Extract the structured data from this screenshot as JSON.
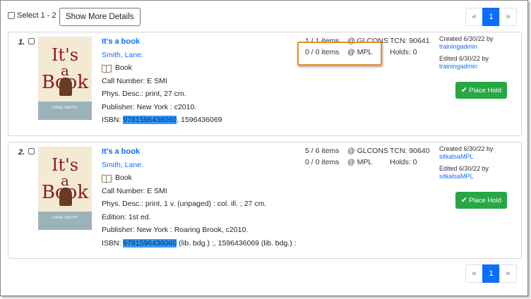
{
  "toolbar": {
    "select_label": "Select 1 - 2",
    "show_details_label": "Show More Details"
  },
  "pager": {
    "prev": "«",
    "page": "1",
    "next": "»"
  },
  "records": [
    {
      "number": "1.",
      "cover": {
        "line1": "It's",
        "line2": "a",
        "line3": "Book",
        "author": "LANE SMITH"
      },
      "title": "It's a book",
      "author": "Smith, Lane.",
      "format": "Book",
      "details": [
        "Call Number: E SMI",
        "Phys. Desc.: print, 27 cm.",
        "Publisher: New York : c2010."
      ],
      "isbn_label": "ISBN: ",
      "isbn_highlight": "9781596436060",
      "isbn_rest": ", 1596436069",
      "holdings": [
        {
          "count": "1 / 1 items",
          "location": "@ GLCONS",
          "extra": "TCN: 90641"
        },
        {
          "count": "0 / 0 items",
          "location": "@ MPL",
          "extra": "Holds: 0"
        }
      ],
      "created": "Created 6/30/22 by",
      "created_by": "trainingadmin",
      "edited": "Edited 6/30/22 by",
      "edited_by": "trainingadmin",
      "hold_label": "Place Hold"
    },
    {
      "number": "2.",
      "cover": {
        "line1": "It's",
        "line2": "a",
        "line3": "Book",
        "author": "LANE SMITH"
      },
      "title": "It's a book",
      "author": "Smith, Lane.",
      "format": "Book",
      "details": [
        "Call Number: E SMI",
        "Phys. Desc.: print, 1 v. (unpaged) : col. ill. ; 27 cm.",
        "Edition: 1st ed.",
        "Publisher: New York : Roaring Brook, c2010."
      ],
      "isbn_label": "ISBN: ",
      "isbn_highlight": "9781596436060",
      "isbn_rest": " (lib. bdg.) :, 1596436069 (lib. bdg.) :",
      "holdings": [
        {
          "count": "5 / 6 items",
          "location": "@ GLCONS",
          "extra": "TCN: 90640"
        },
        {
          "count": "0 / 0 items",
          "location": "@ MPL",
          "extra": "Holds: 0"
        }
      ],
      "created": "Created 6/30/22 by",
      "created_by": "sitkalsaMPL",
      "edited": "Edited 6/30/22 by",
      "edited_by": "sitkalsaMPL",
      "hold_label": "Place Hold"
    }
  ],
  "icons": {
    "book": "book-icon",
    "check": "check-icon"
  },
  "colors": {
    "link": "#0d6efd",
    "hold_button": "#28a745",
    "highlight": "#3399ff",
    "callout": "#f08a24"
  }
}
